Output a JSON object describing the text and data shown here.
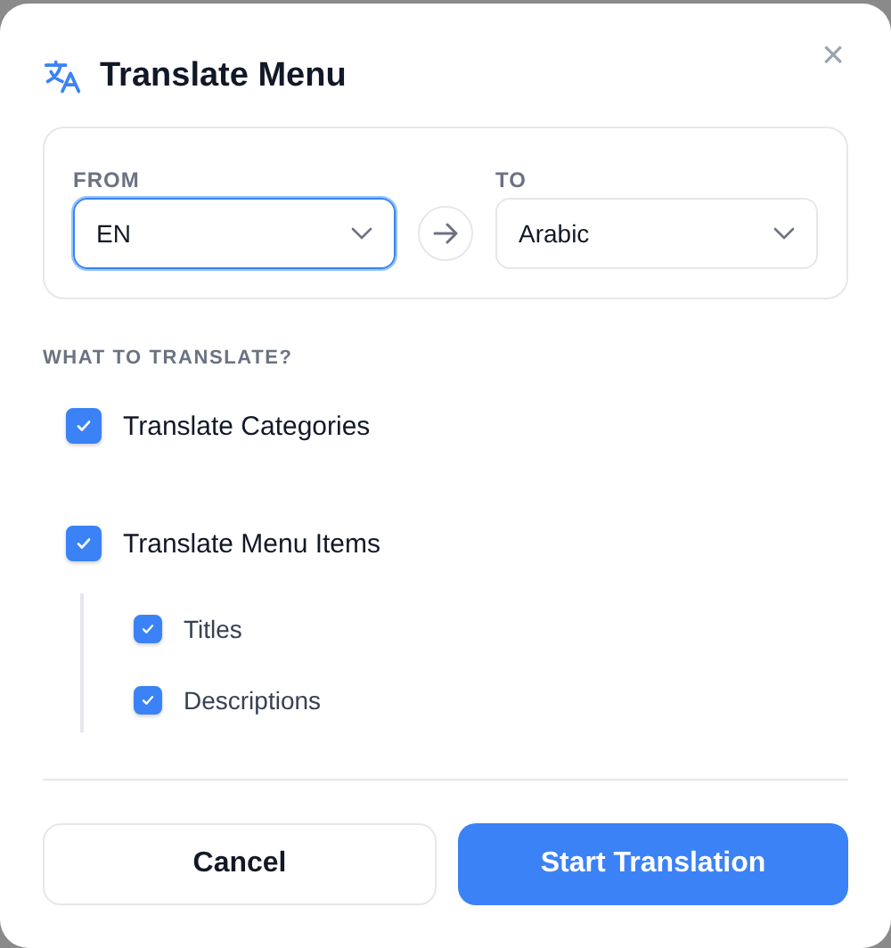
{
  "dialog": {
    "title": "Translate Menu",
    "close_glyph": "×"
  },
  "languages": [
    {
      "label": "FROM",
      "value": "EN",
      "focused": true
    },
    {
      "label": "TO",
      "value": "Arabic",
      "focused": false
    }
  ],
  "section_heading": "WHAT TO TRANSLATE?",
  "options": [
    {
      "label": "Translate Categories",
      "checked": true
    },
    {
      "label": "Translate Menu Items",
      "checked": true,
      "children": [
        {
          "label": "Titles",
          "checked": true
        },
        {
          "label": "Descriptions",
          "checked": true
        }
      ]
    }
  ],
  "buttons": [
    {
      "label": "Cancel",
      "kind": "secondary"
    },
    {
      "label": "Start Translation",
      "kind": "primary"
    }
  ]
}
